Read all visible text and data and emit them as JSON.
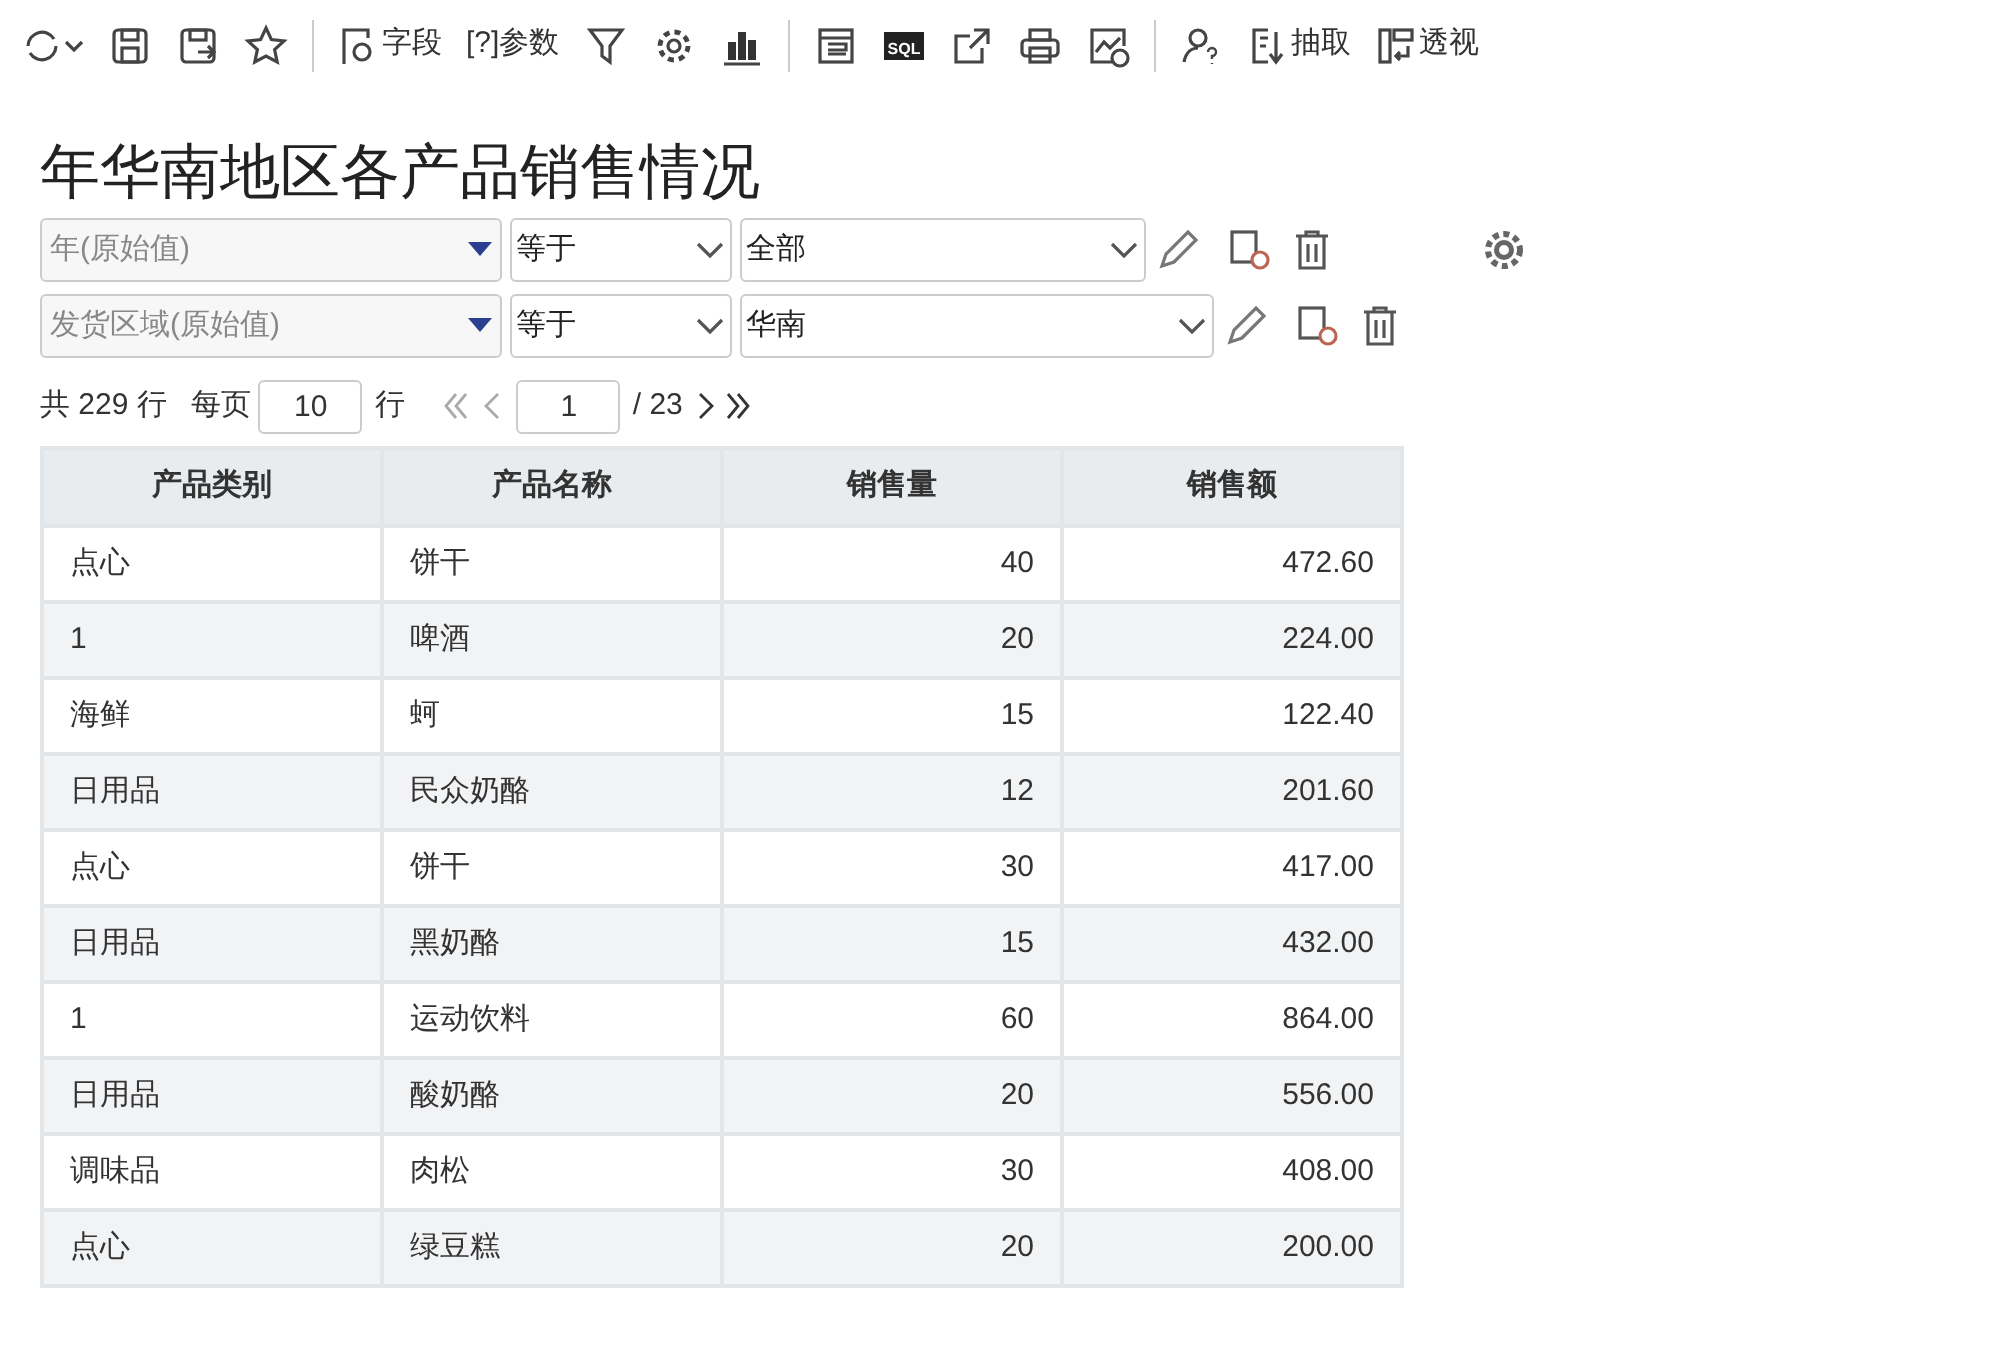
{
  "toolbar": {
    "field_label": "字段",
    "param_label": "[?]参数",
    "extract_label": "抽取",
    "pivot_label": "透视",
    "sql_label": "SQL"
  },
  "title": "年华南地区各产品销售情况",
  "filters": [
    {
      "field": "年(原始值)",
      "operator": "等于",
      "value": "全部"
    },
    {
      "field": "发货区域(原始值)",
      "operator": "等于",
      "value": "华南"
    }
  ],
  "pagination": {
    "total": "共 229 行",
    "per_page_label": "每页",
    "per_page": "10",
    "rows_label": "行",
    "page": "1",
    "pages": "/ 23"
  },
  "table": {
    "columns": [
      "产品类别",
      "产品名称",
      "销售量",
      "销售额"
    ],
    "rows": [
      [
        "点心",
        "饼干",
        "40",
        "472.60"
      ],
      [
        "1",
        "啤酒",
        "20",
        "224.00"
      ],
      [
        "海鲜",
        "蚵",
        "15",
        "122.40"
      ],
      [
        "日用品",
        "民众奶酪",
        "12",
        "201.60"
      ],
      [
        "点心",
        "饼干",
        "30",
        "417.00"
      ],
      [
        "日用品",
        "黑奶酪",
        "15",
        "432.00"
      ],
      [
        "1",
        "运动饮料",
        "60",
        "864.00"
      ],
      [
        "日用品",
        "酸奶酪",
        "20",
        "556.00"
      ],
      [
        "调味品",
        "肉松",
        "30",
        "408.00"
      ],
      [
        "点心",
        "绿豆糕",
        "20",
        "200.00"
      ]
    ]
  }
}
